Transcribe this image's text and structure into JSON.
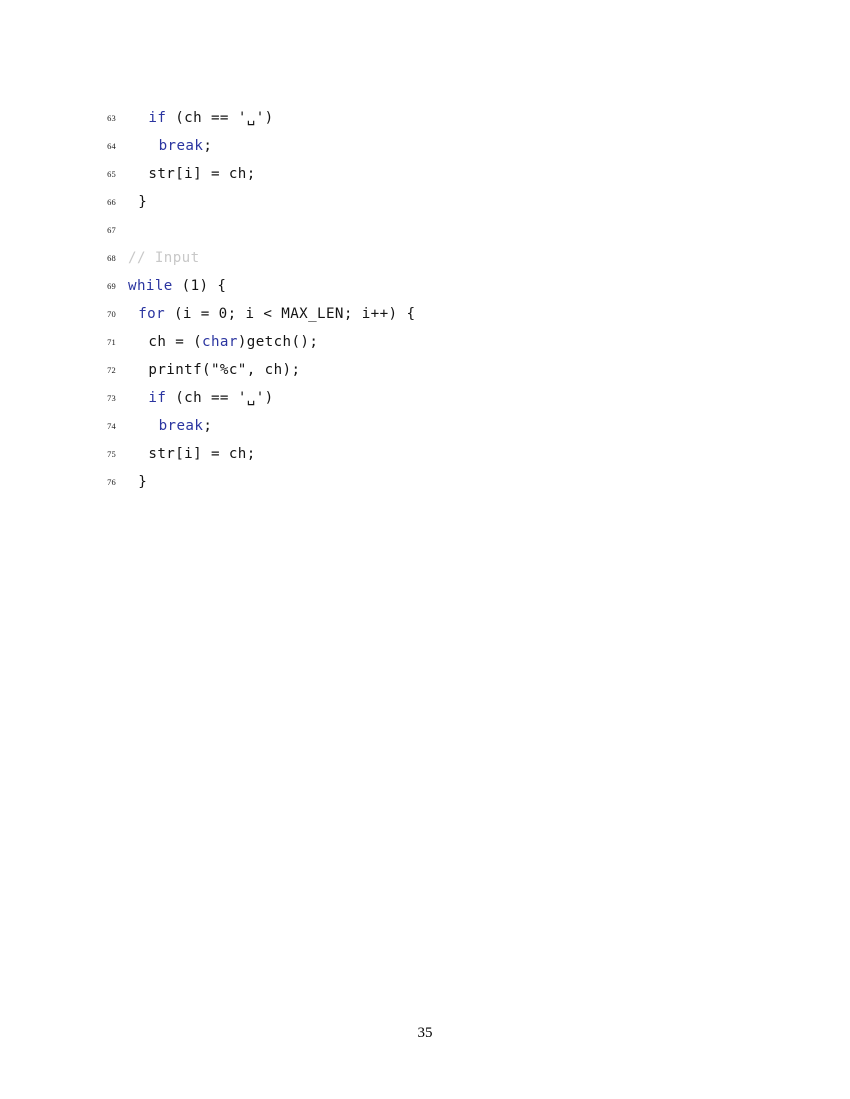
{
  "document": {
    "page_number": "35",
    "language": "c",
    "colors": {
      "keyword": "#2b35a0",
      "comment": "#c8c8c8",
      "plain": "#141414",
      "line_number": "#1a1a1a",
      "background": "#ffffff"
    }
  },
  "listing": {
    "first_line_number": 63,
    "last_line_number": 76,
    "lines": [
      {
        "number": "63",
        "indent": 2,
        "text": "if (ch == '␣')",
        "tokens": [
          {
            "t": "if",
            "k": "kw"
          },
          {
            "t": " (ch == '",
            "k": "pln"
          },
          {
            "t": "␣",
            "k": "vspace"
          },
          {
            "t": "')",
            "k": "pln"
          }
        ]
      },
      {
        "number": "64",
        "indent": 3,
        "text": "break;",
        "tokens": [
          {
            "t": "break",
            "k": "kw"
          },
          {
            "t": ";",
            "k": "pln"
          }
        ]
      },
      {
        "number": "65",
        "indent": 2,
        "text": "str[i] = ch;",
        "tokens": [
          {
            "t": "str[i] = ch;",
            "k": "pln"
          }
        ]
      },
      {
        "number": "66",
        "indent": 1,
        "text": "}",
        "tokens": [
          {
            "t": "}",
            "k": "pln"
          }
        ]
      },
      {
        "number": "67",
        "indent": 0,
        "text": "",
        "tokens": []
      },
      {
        "number": "68",
        "indent": 0,
        "text": "// Input",
        "tokens": [
          {
            "t": "// Input",
            "k": "cmt"
          }
        ]
      },
      {
        "number": "69",
        "indent": 0,
        "text": "while (1) {",
        "tokens": [
          {
            "t": "while",
            "k": "kw"
          },
          {
            "t": " (1) {",
            "k": "pln"
          }
        ]
      },
      {
        "number": "70",
        "indent": 1,
        "text": "for (i = 0; i < MAX_LEN; i++) {",
        "tokens": [
          {
            "t": "for",
            "k": "kw"
          },
          {
            "t": " (i = 0; i < MAX_LEN; i++) {",
            "k": "pln"
          }
        ]
      },
      {
        "number": "71",
        "indent": 2,
        "text": "ch = (char)getch();",
        "tokens": [
          {
            "t": "ch = (",
            "k": "pln"
          },
          {
            "t": "char",
            "k": "kw"
          },
          {
            "t": ")getch();",
            "k": "pln"
          }
        ]
      },
      {
        "number": "72",
        "indent": 2,
        "text": "printf(\"%c\", ch);",
        "tokens": [
          {
            "t": "printf(\"%c\", ch);",
            "k": "pln"
          }
        ]
      },
      {
        "number": "73",
        "indent": 2,
        "text": "if (ch == '␣')",
        "tokens": [
          {
            "t": "if",
            "k": "kw"
          },
          {
            "t": " (ch == '",
            "k": "pln"
          },
          {
            "t": "␣",
            "k": "vspace"
          },
          {
            "t": "')",
            "k": "pln"
          }
        ]
      },
      {
        "number": "74",
        "indent": 3,
        "text": "break;",
        "tokens": [
          {
            "t": "break",
            "k": "kw"
          },
          {
            "t": ";",
            "k": "pln"
          }
        ]
      },
      {
        "number": "75",
        "indent": 2,
        "text": "str[i] = ch;",
        "tokens": [
          {
            "t": "str[i] = ch;",
            "k": "pln"
          }
        ]
      },
      {
        "number": "76",
        "indent": 1,
        "text": "}",
        "tokens": [
          {
            "t": "}",
            "k": "pln"
          }
        ]
      }
    ]
  }
}
